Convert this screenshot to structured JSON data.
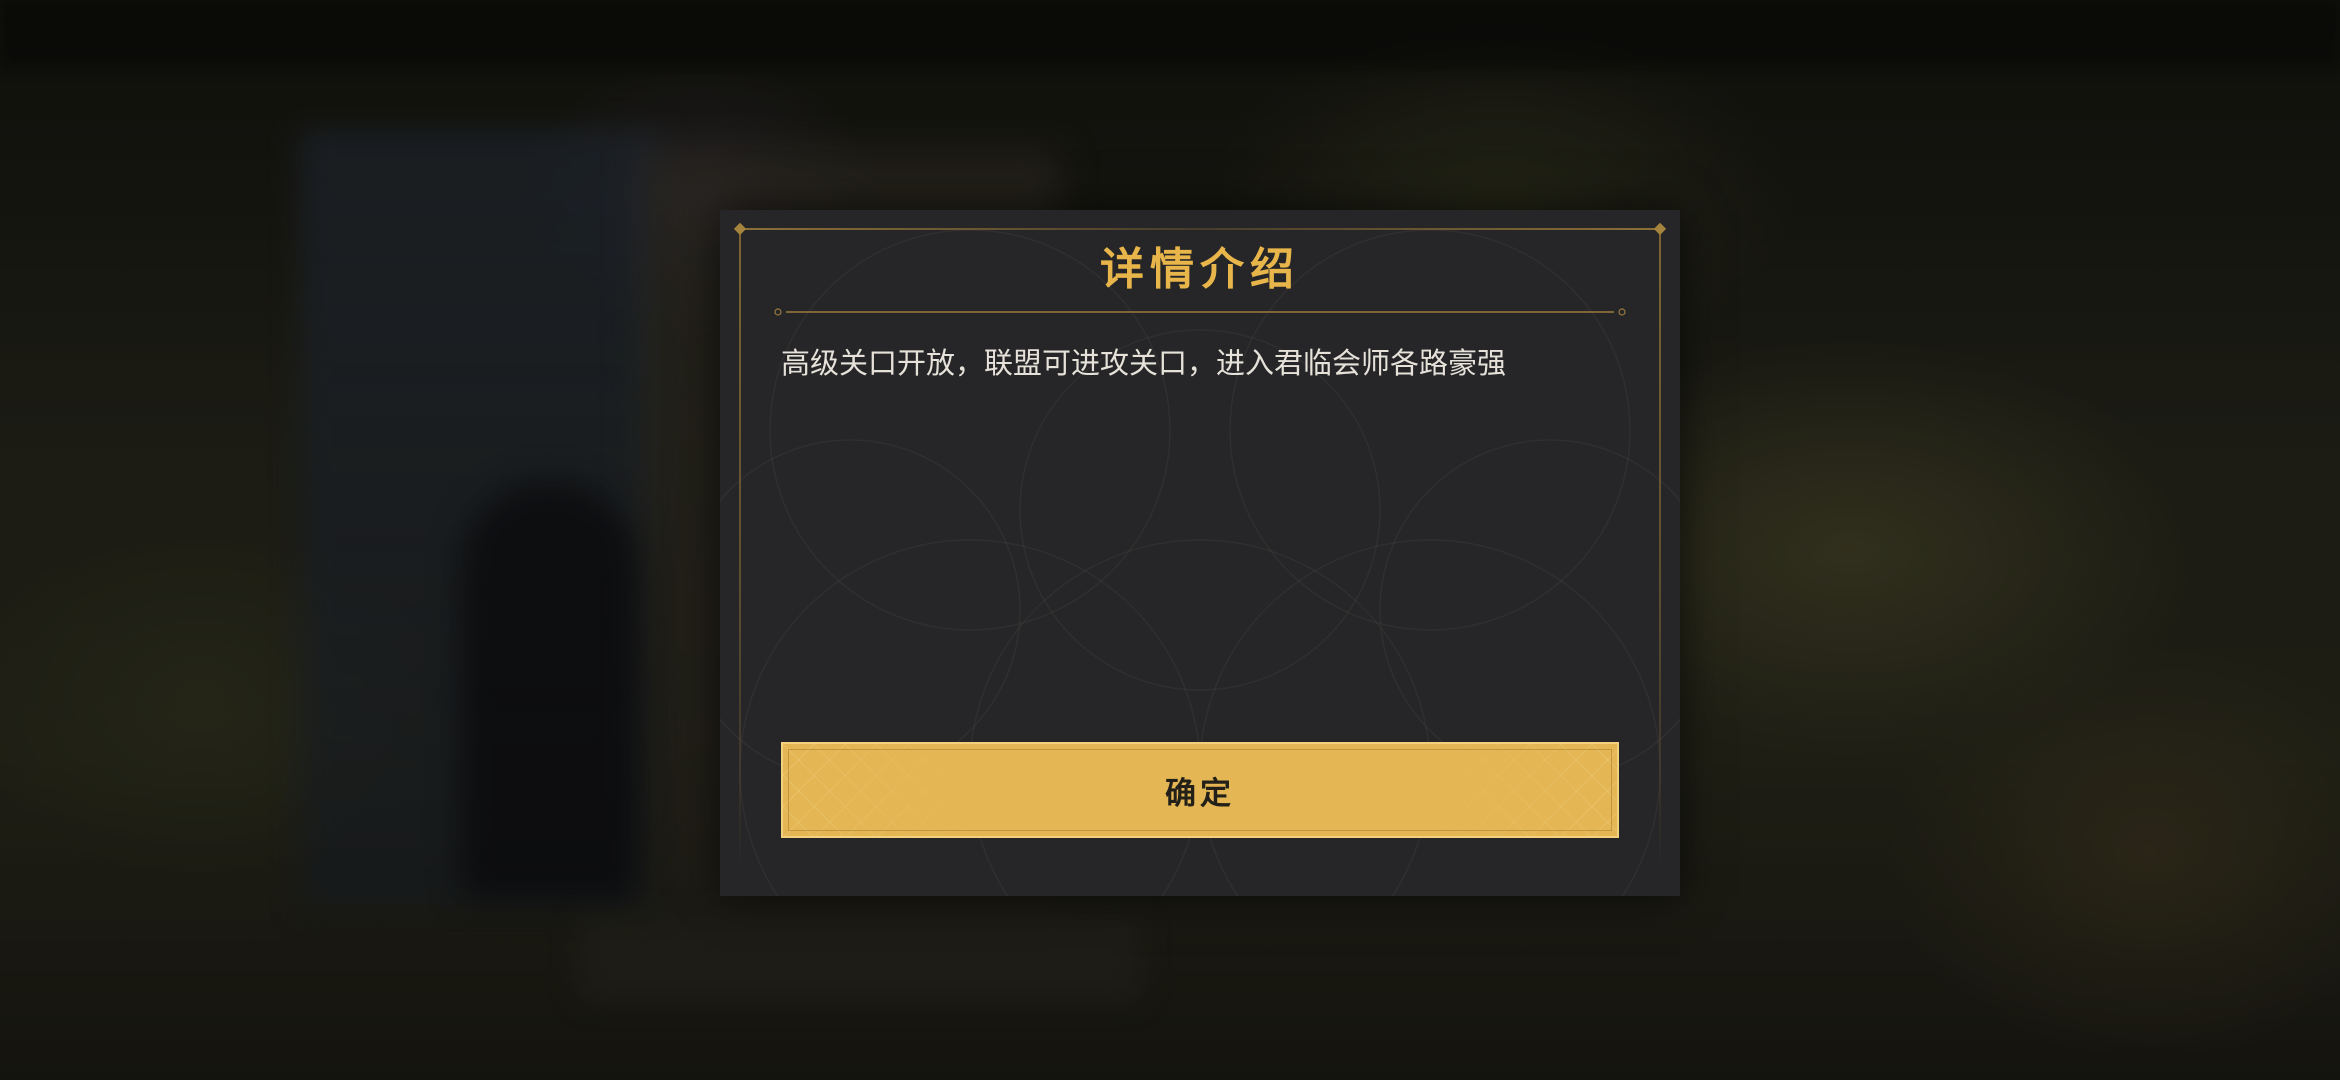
{
  "dialog": {
    "title": "详情介绍",
    "description": "高级关口开放，联盟可进攻关口，进入君临会师各路豪强",
    "confirm_label": "确定"
  },
  "colors": {
    "title": "#e8b54a",
    "button": "#e4b754",
    "panel": "#262628",
    "frame": "#a5843e"
  },
  "icons": {
    "corner_ornament": "diamond-ornament-icon"
  }
}
